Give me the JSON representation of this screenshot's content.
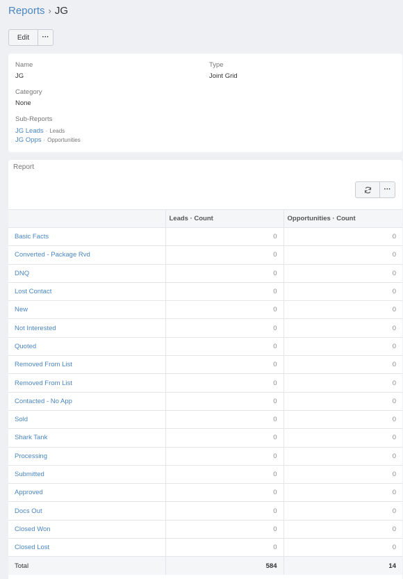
{
  "breadcrumb": {
    "parent": "Reports",
    "separator": "›",
    "current": "JG"
  },
  "actions": {
    "edit_label": "Edit",
    "more_label": "···"
  },
  "details": {
    "name_label": "Name",
    "name_value": "JG",
    "type_label": "Type",
    "type_value": "Joint Grid",
    "category_label": "Category",
    "category_value": "None",
    "subreports_label": "Sub-Reports",
    "subreports": [
      {
        "name": "JG Leads",
        "entity": "Leads"
      },
      {
        "name": "JG Opps",
        "entity": "Opportunities"
      }
    ],
    "subreport_separator": "·"
  },
  "report": {
    "title": "Report",
    "more_label": "···",
    "columns": [
      "",
      "Leads · Count",
      "Opportunities · Count"
    ],
    "rows": [
      {
        "label": "Basic Facts",
        "leads": "0",
        "opps": "0"
      },
      {
        "label": "Converted - Package Rvd",
        "leads": "0",
        "opps": "0"
      },
      {
        "label": "DNQ",
        "leads": "0",
        "opps": "0"
      },
      {
        "label": "Lost Contact",
        "leads": "0",
        "opps": "0"
      },
      {
        "label": "New",
        "leads": "0",
        "opps": "0"
      },
      {
        "label": "Not Interested",
        "leads": "0",
        "opps": "0"
      },
      {
        "label": "Quoted",
        "leads": "0",
        "opps": "0"
      },
      {
        "label": "Removed From List",
        "leads": "0",
        "opps": "0"
      },
      {
        "label": "Removed From List",
        "leads": "0",
        "opps": "0"
      },
      {
        "label": "Contacted - No App",
        "leads": "0",
        "opps": "0"
      },
      {
        "label": "Sold",
        "leads": "0",
        "opps": "0"
      },
      {
        "label": "Shark Tank",
        "leads": "0",
        "opps": "0"
      },
      {
        "label": "Processing",
        "leads": "0",
        "opps": "0"
      },
      {
        "label": "Submitted",
        "leads": "0",
        "opps": "0"
      },
      {
        "label": "Approved",
        "leads": "0",
        "opps": "0"
      },
      {
        "label": "Docs Out",
        "leads": "0",
        "opps": "0"
      },
      {
        "label": "Closed Won",
        "leads": "0",
        "opps": "0"
      },
      {
        "label": "Closed Lost",
        "leads": "0",
        "opps": "0"
      }
    ],
    "total": {
      "label": "Total",
      "leads": "584",
      "opps": "14"
    }
  },
  "icons": {
    "refresh": "refresh-icon",
    "more": "ellipsis-icon"
  },
  "colors": {
    "link": "#4a86c1",
    "background": "#eef0f3"
  }
}
